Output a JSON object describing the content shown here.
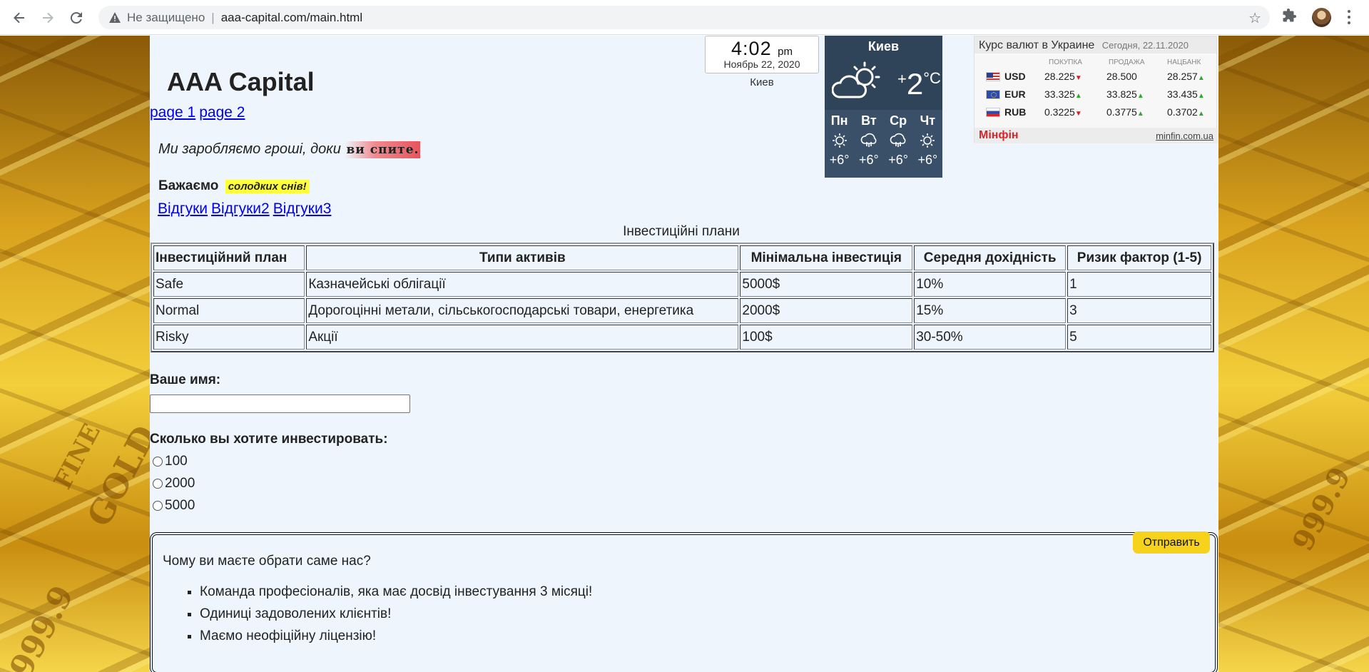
{
  "browser": {
    "security_label": "Не защищено",
    "url": "aaa-capital.com/main.html"
  },
  "site": {
    "title": "AAA Capital",
    "page_links": [
      "page 1",
      "page 2"
    ],
    "slogan": "Ми заробляємо гроші, доки",
    "slogan_highlight": "ви спите.",
    "wish_label": "Бажаємо",
    "wish_highlight": "солодких снів!",
    "review_links": [
      "Відгуки",
      "Відгуки2",
      "Відгуки3"
    ]
  },
  "clock": {
    "time": "4:02",
    "ampm": "pm",
    "date": "Ноябрь 22, 2020",
    "city": "Киев"
  },
  "weather": {
    "city": "Киев",
    "temp_sign": "+",
    "temp": "2",
    "unit": "°C",
    "current_icon": "cloud-sun-icon",
    "days": [
      {
        "name": "Пн",
        "icon": "sun-icon",
        "temp": "+6°"
      },
      {
        "name": "Вт",
        "icon": "cloud-rain-icon",
        "temp": "+6°"
      },
      {
        "name": "Ср",
        "icon": "cloud-rain-icon",
        "temp": "+6°"
      },
      {
        "name": "Чт",
        "icon": "sun-icon",
        "temp": "+6°"
      }
    ]
  },
  "currency": {
    "title": "Курс валют в Украине",
    "date": "Сегодня, 22.11.2020",
    "columns": [
      "ПОКУПКА",
      "ПРОДАЖА",
      "НАЦБАНК"
    ],
    "rows": [
      {
        "code": "USD",
        "buy": "28.225",
        "buy_dir": "down",
        "sell": "28.500",
        "sell_dir": "",
        "nbu": "28.257",
        "nbu_dir": "up"
      },
      {
        "code": "EUR",
        "buy": "33.325",
        "buy_dir": "up",
        "sell": "33.825",
        "sell_dir": "up",
        "nbu": "33.435",
        "nbu_dir": "up"
      },
      {
        "code": "RUB",
        "buy": "0.3225",
        "buy_dir": "down",
        "sell": "0.3775",
        "sell_dir": "up",
        "nbu": "0.3702",
        "nbu_dir": "up"
      }
    ],
    "brand": "Мінфін",
    "link": "minfin.com.ua"
  },
  "table": {
    "caption": "Інвестиційні плани",
    "headers": [
      "Інвестиційний план",
      "Типи активів",
      "Мінімальна інвестиція",
      "Середня дохідність",
      "Ризик фактор (1-5)"
    ],
    "rows": [
      [
        "Safe",
        "Казначейські облігації",
        "5000$",
        "10%",
        "1"
      ],
      [
        "Normal",
        "Дорогоцінні метали, сільськогосподарські товари, енергетика",
        "2000$",
        "15%",
        "3"
      ],
      [
        "Risky",
        "Акції",
        "100$",
        "30-50%",
        "5"
      ]
    ]
  },
  "form": {
    "name_label": "Ваше имя:",
    "name_value": "",
    "amount_label": "Сколько вы хотите инвестировать:",
    "amount_options": [
      "100",
      "2000",
      "5000"
    ],
    "submit_label": "Отправить"
  },
  "why": {
    "title": "Чому ви маєте обрати саме нас?",
    "items": [
      "Команда професіоналів, яка має досвід інвестування 3 місяці!",
      "Одиниці задоволених клієнтів!",
      "Маємо неофіційну ліцензію!"
    ]
  },
  "background": {
    "ingot_text": [
      "FINE",
      "GOLD",
      "999.9"
    ]
  }
}
